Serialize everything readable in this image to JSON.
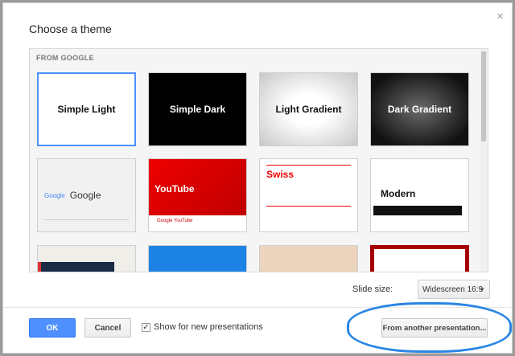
{
  "dialog": {
    "title": "Choose a theme",
    "close_glyph": "×"
  },
  "gallery": {
    "section_label": "FROM GOOGLE",
    "themes": [
      {
        "name": "Simple Light"
      },
      {
        "name": "Simple Dark"
      },
      {
        "name": "Light Gradient"
      },
      {
        "name": "Dark Gradient"
      },
      {
        "name": "Google",
        "logo": "Google"
      },
      {
        "name": "YouTube",
        "footer": "Google YouTube"
      },
      {
        "name": "Swiss"
      },
      {
        "name": "Modern"
      }
    ]
  },
  "slide_size": {
    "label": "Slide size:",
    "value": "Widescreen 16:9",
    "arrow": "▼"
  },
  "footer": {
    "ok_label": "OK",
    "cancel_label": "Cancel",
    "show_checkbox_checked": true,
    "check_glyph": "✓",
    "show_label": "Show for new presentations",
    "another_label": "From another presentation..."
  },
  "colors": {
    "accent": "#4d90fe",
    "highlight": "#2a86e4"
  }
}
